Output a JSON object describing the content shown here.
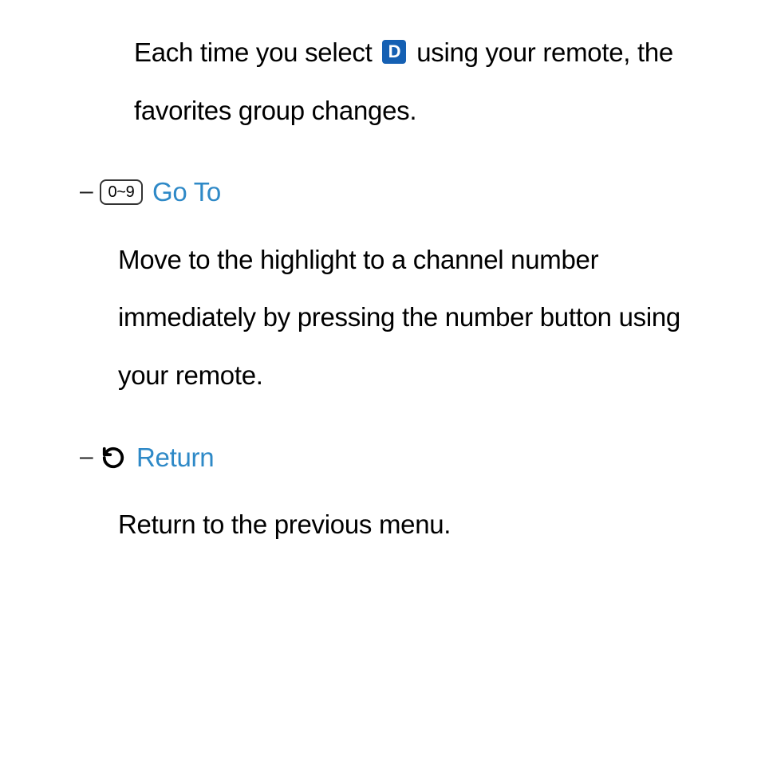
{
  "intro": {
    "pre": "Each time you select ",
    "badge": "D",
    "post": " using your remote, the favorites group changes."
  },
  "items": [
    {
      "icon_label": "0~9",
      "title": "Go To",
      "desc": "Move to the highlight to a channel number immediately by pressing the number button using your remote."
    },
    {
      "icon_label": "↺",
      "title": "Return",
      "desc": "Return to the previous menu."
    }
  ]
}
